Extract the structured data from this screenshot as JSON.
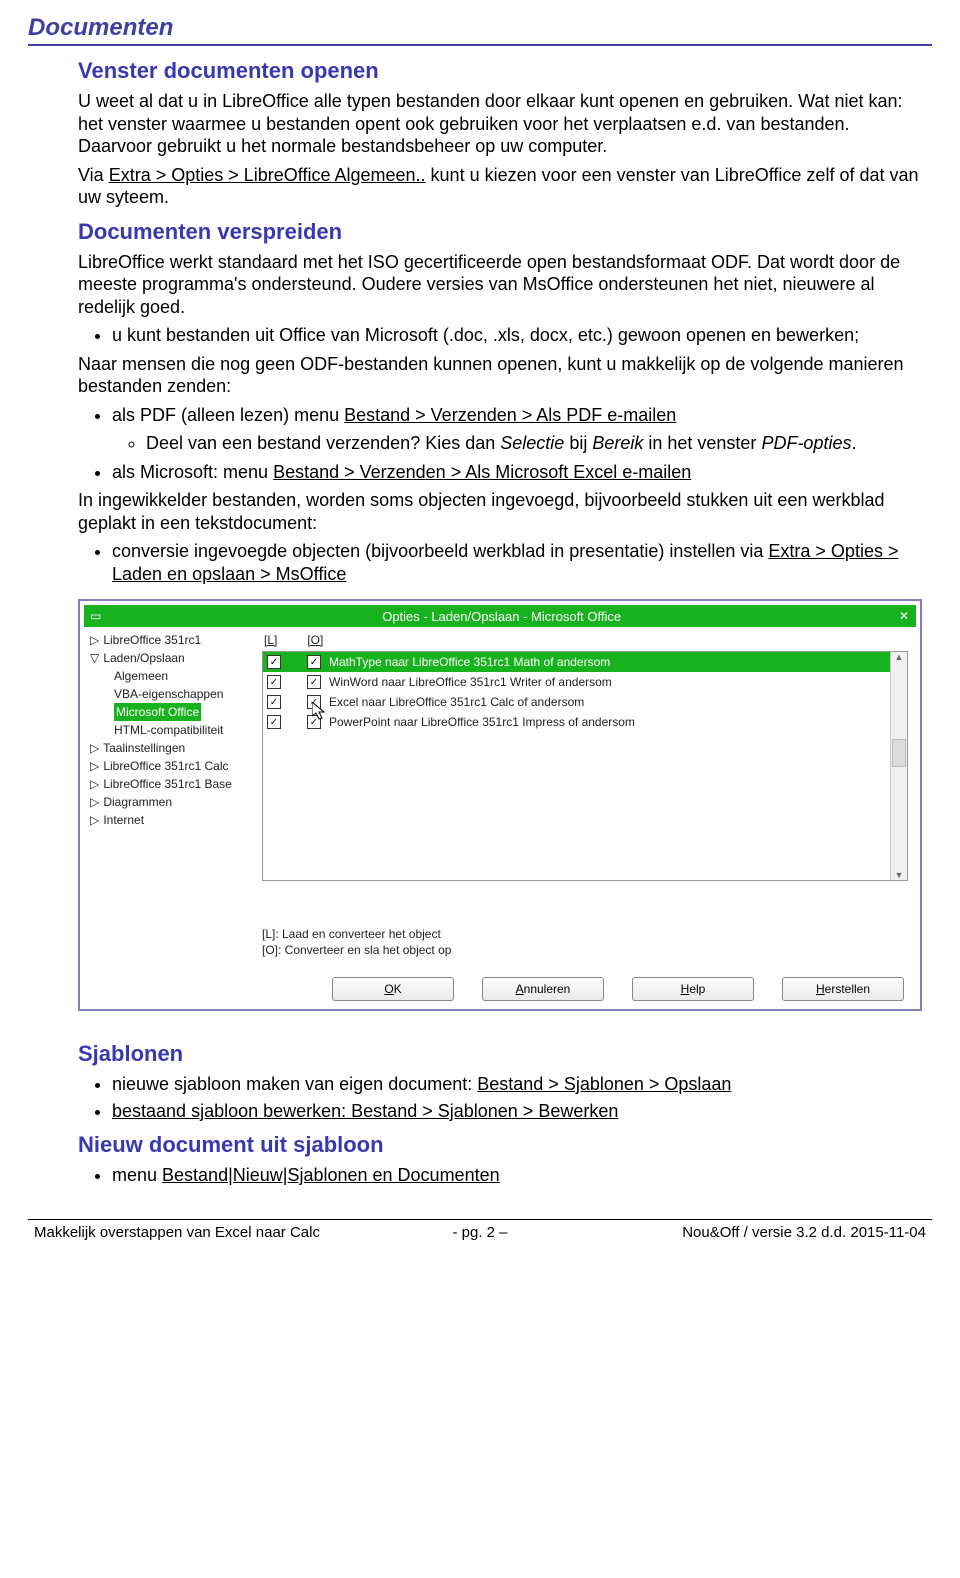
{
  "doc_title": "Documenten",
  "h_open": "Venster documenten openen",
  "p_open1": "U weet al dat u in LibreOffice alle typen bestanden door elkaar kunt openen en gebruiken. Wat niet kan: het venster waarmee u bestanden opent ook gebruiken voor het verplaatsen e.d. van bestanden. Daarvoor gebruikt u het normale bestandsbeheer op uw computer.",
  "p_open2a": "Via ",
  "p_open_link": "Extra > Opties > LibreOffice Algemeen..",
  "p_open2b": " kunt u kiezen voor een venster van LibreOffice zelf of dat van uw syteem.",
  "h_spread": "Documenten verspreiden",
  "p_spread": "LibreOffice werkt standaard met het ISO gecertificeerde open bestandsformaat ODF. Dat wordt door de meeste programma's ondersteund. Oudere versies van MsOffice ondersteunen het niet, nieuwere al redelijk goed.",
  "li_open": "u kunt bestanden uit Office van Microsoft (.doc, .xls, docx, etc.) gewoon openen en bewerken;",
  "p_senders": "Naar mensen die nog geen ODF-bestanden kunnen openen, kunt u makkelijk op de volgende manieren bestanden zenden:",
  "li_pdf_a": "als PDF (alleen lezen) menu ",
  "li_pdf_link": "Bestand > Verzenden > Als PDF e-mailen",
  "li_pdf_sub_a": "Deel van een bestand verzenden? Kies dan ",
  "li_pdf_sub_i1": "Selectie",
  "li_pdf_sub_b": " bij ",
  "li_pdf_sub_i2": "Bereik",
  "li_pdf_sub_c": " in het venster ",
  "li_pdf_sub_i3": "PDF-opties",
  "li_excel_a": "als Microsoft: menu ",
  "li_excel_link": "Bestand > Verzenden > Als Microsoft Excel e-mailen",
  "p_embed": "In ingewikkelder bestanden, worden soms objecten ingevoegd, bijvoorbeeld stukken uit een werkblad geplakt in een tekstdocument:",
  "li_conv_a": "conversie ingevoegde objecten (bijvoorbeeld werkblad in presentatie) instellen via ",
  "li_conv_link": "Extra > Opties > Laden en opslaan > MsOffice",
  "dialog": {
    "title": "Opties - Laden/Opslaan - Microsoft Office",
    "tree": [
      {
        "t": "LibreOffice 351rc1",
        "tri": "▷"
      },
      {
        "t": "Laden/Opslaan",
        "tri": "▽",
        "children": [
          "Algemeen",
          "VBA-eigenschappen",
          "Microsoft Office",
          "HTML-compatibiliteit"
        ],
        "hl": "Microsoft Office"
      },
      {
        "t": "Taalinstellingen",
        "tri": "▷"
      },
      {
        "t": "LibreOffice 351rc1 Calc",
        "tri": "▷"
      },
      {
        "t": "LibreOffice 351rc1 Base",
        "tri": "▷"
      },
      {
        "t": "Diagrammen",
        "tri": "▷"
      },
      {
        "t": "Internet",
        "tri": "▷"
      }
    ],
    "col_L": "[L]",
    "col_O": "[O]",
    "rows": [
      {
        "l": true,
        "o": true,
        "txt": "MathType naar LibreOffice 351rc1 Math of andersom",
        "sel": true
      },
      {
        "l": true,
        "o": true,
        "txt": "WinWord naar LibreOffice 351rc1 Writer of andersom"
      },
      {
        "l": true,
        "o": true,
        "txt": "Excel naar LibreOffice 351rc1 Calc of andersom"
      },
      {
        "l": true,
        "o": true,
        "txt": "PowerPoint naar LibreOffice 351rc1 Impress of andersom"
      }
    ],
    "cap_L": "[L]: Laad en converteer het object",
    "cap_O": "[O]: Converteer en sla het object op",
    "buttons": {
      "ok": "OK",
      "cancel": "Annuleren",
      "help": "Help",
      "reset": "Herstellen"
    },
    "ok_accel": "O",
    "cancel_accel": "A",
    "help_accel": "H",
    "reset_accel": "H"
  },
  "h_templates": "Sjablonen",
  "li_tpl1_a": "nieuwe sjabloon maken van eigen document: ",
  "li_tpl1_link": "Bestand > Sjablonen > Opslaan",
  "li_tpl2_link": "bestaand sjabloon bewerken: Bestand > Sjablonen > Bewerken",
  "h_newdoc": "Nieuw document uit sjabloon",
  "li_newdoc_a": "menu ",
  "li_newdoc_link": "Bestand|Nieuw|Sjablonen en Documenten",
  "footer": {
    "left": "Makkelijk overstappen van Excel naar Calc",
    "mid": "- pg. 2 –",
    "right": "Nou&Off / versie 3.2 d.d. 2015-11-04"
  }
}
